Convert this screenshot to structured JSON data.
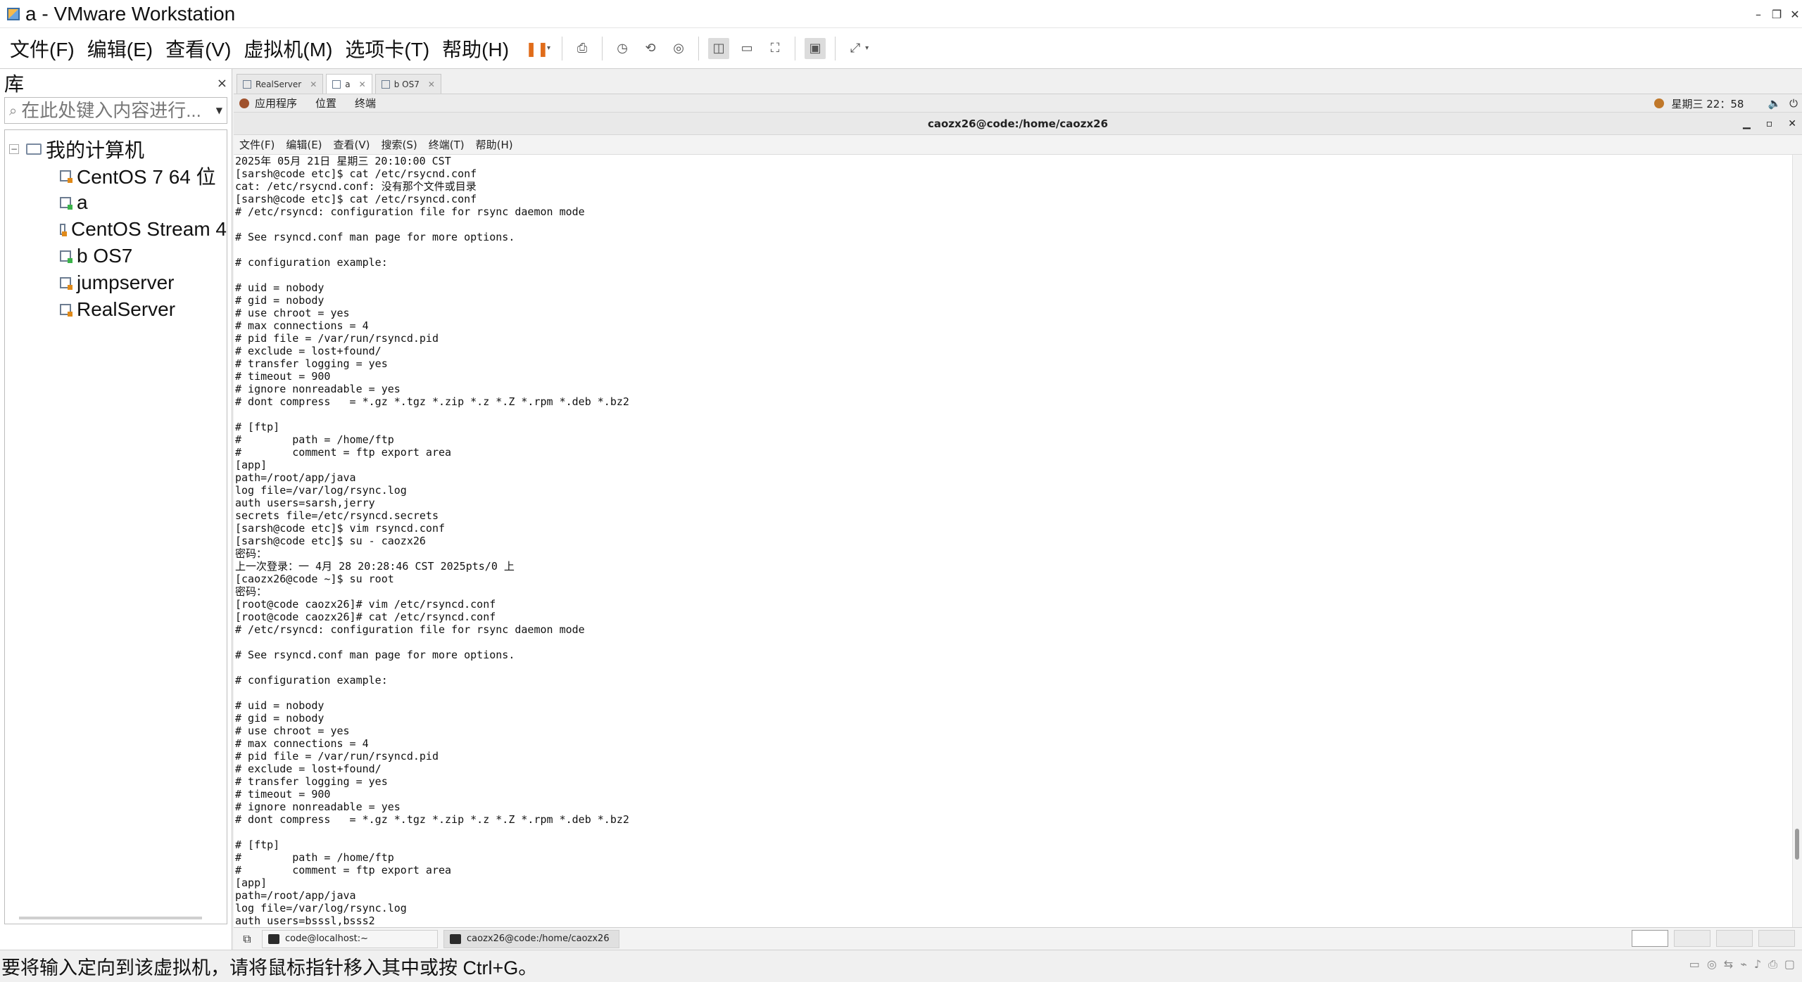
{
  "window": {
    "title": "a - VMware Workstation",
    "minimize": "–",
    "restore": "❐",
    "close": "✕"
  },
  "menubar": {
    "items": [
      "文件(F)",
      "编辑(E)",
      "查看(V)",
      "虚拟机(M)",
      "选项卡(T)",
      "帮助(H)"
    ],
    "toolbar_icons": [
      "pause-icon",
      "send-ctrl-alt-del-icon",
      "snapshot-icon",
      "revert-snapshot-icon",
      "snapshot-manager-icon",
      "library-view-icon",
      "thumbnail-view-icon",
      "fullscreen-icon",
      "console-view-icon",
      "stretch-icon"
    ]
  },
  "library": {
    "title": "库",
    "close": "×",
    "search_placeholder": "在此处键入内容进行...",
    "root": "我的计算机",
    "items": [
      {
        "label": "CentOS 7 64 位",
        "state": "off"
      },
      {
        "label": "a",
        "state": "on"
      },
      {
        "label": "CentOS Stream 4",
        "state": "off"
      },
      {
        "label": "b OS7",
        "state": "on"
      },
      {
        "label": "jumpserver",
        "state": "off"
      },
      {
        "label": "RealServer",
        "state": "off"
      }
    ]
  },
  "vm_tabs": [
    {
      "label": "RealServer",
      "active": false
    },
    {
      "label": "a",
      "active": true
    },
    {
      "label": "b OS7",
      "active": false
    }
  ],
  "guest_topbar": {
    "applications": "应用程序",
    "places": "位置",
    "terminal": "终端",
    "clock": "星期三 22：58"
  },
  "terminal": {
    "title": "caozx26@code:/home/caozx26",
    "menu": [
      "文件(F)",
      "编辑(E)",
      "查看(V)",
      "搜索(S)",
      "终端(T)",
      "帮助(H)"
    ],
    "lines": [
      "2025年 05月 21日 星期三 20:10:00 CST",
      "[sarsh@code etc]$ cat /etc/rsycnd.conf",
      "cat: /etc/rsycnd.conf: 没有那个文件或目录",
      "[sarsh@code etc]$ cat /etc/rsyncd.conf",
      "# /etc/rsyncd: configuration file for rsync daemon mode",
      "",
      "# See rsyncd.conf man page for more options.",
      "",
      "# configuration example:",
      "",
      "# uid = nobody",
      "# gid = nobody",
      "# use chroot = yes",
      "# max connections = 4",
      "# pid file = /var/run/rsyncd.pid",
      "# exclude = lost+found/",
      "# transfer logging = yes",
      "# timeout = 900",
      "# ignore nonreadable = yes",
      "# dont compress   = *.gz *.tgz *.zip *.z *.Z *.rpm *.deb *.bz2",
      "",
      "# [ftp]",
      "#        path = /home/ftp",
      "#        comment = ftp export area",
      "[app]",
      "path=/root/app/java",
      "log file=/var/log/rsync.log",
      "auth users=sarsh,jerry",
      "secrets file=/etc/rsyncd.secrets",
      "[sarsh@code etc]$ vim rsyncd.conf",
      "[sarsh@code etc]$ su - caozx26",
      "密码：",
      "上一次登录：一 4月 28 20:28:46 CST 2025pts/0 上",
      "[caozx26@code ~]$ su root",
      "密码：",
      "[root@code caozx26]# vim /etc/rsyncd.conf",
      "[root@code caozx26]# cat /etc/rsyncd.conf",
      "# /etc/rsyncd: configuration file for rsync daemon mode",
      "",
      "# See rsyncd.conf man page for more options.",
      "",
      "# configuration example:",
      "",
      "# uid = nobody",
      "# gid = nobody",
      "# use chroot = yes",
      "# max connections = 4",
      "# pid file = /var/run/rsyncd.pid",
      "# exclude = lost+found/",
      "# transfer logging = yes",
      "# timeout = 900",
      "# ignore nonreadable = yes",
      "# dont compress   = *.gz *.tgz *.zip *.z *.Z *.rpm *.deb *.bz2",
      "",
      "# [ftp]",
      "#        path = /home/ftp",
      "#        comment = ftp export area",
      "[app]",
      "path=/root/app/java",
      "log file=/var/log/rsync.log",
      "auth users=bsssl,bsss2"
    ]
  },
  "taskbar": {
    "tasks": [
      {
        "label": "code@localhost:~",
        "active": false
      },
      {
        "label": "caozx26@code:/home/caozx26",
        "active": true
      }
    ]
  },
  "statusbar": {
    "message": "要将输入定向到该虚拟机，请将鼠标指针移入其中或按 Ctrl+G。"
  }
}
